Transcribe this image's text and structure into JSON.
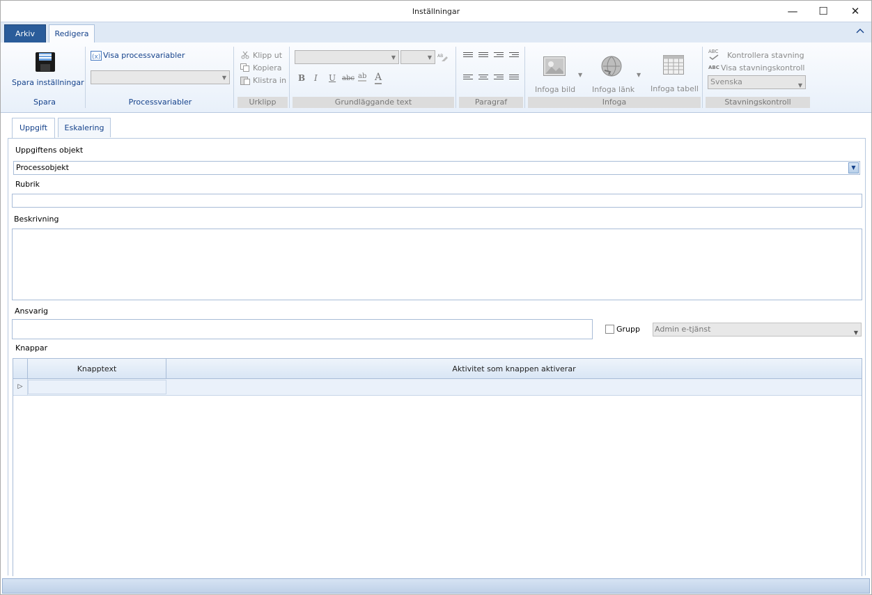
{
  "window": {
    "title": "Inställningar",
    "minimize": "—",
    "maximize": "☐",
    "close": "✕"
  },
  "ribbon_tabs": {
    "arkiv": "Arkiv",
    "redigera": "Redigera",
    "collapse_icon": "chevron-up-icon"
  },
  "ribbon": {
    "spara": {
      "button": "Spara inställningar",
      "group": "Spara"
    },
    "processvariabler": {
      "visa": "Visa processvariabler",
      "group": "Processvariabler"
    },
    "urklipp": {
      "klipp_ut": "Klipp ut",
      "kopiera": "Kopiera",
      "klistra_in": "Klistra in",
      "group": "Urklipp"
    },
    "grundlaggande": {
      "bold": "B",
      "italic": "I",
      "underline": "U",
      "strike": "abc",
      "highlight": "ab",
      "fontcolor": "A",
      "group": "Grundläggande text"
    },
    "paragraf": {
      "group": "Paragraf"
    },
    "infoga": {
      "bild": "Infoga bild",
      "lank": "Infoga länk",
      "tabell": "Infoga tabell",
      "group": "Infoga"
    },
    "stavning": {
      "kontrollera": "Kontrollera stavning",
      "visa": "Visa stavningskontroll",
      "language": "Svenska",
      "group": "Stavningskontroll",
      "abc": "ABC"
    }
  },
  "content_tabs": {
    "uppgift": "Uppgift",
    "eskalering": "Eskalering"
  },
  "form": {
    "uppgiftens_objekt_label": "Uppgiftens objekt",
    "uppgiftens_objekt_value": "Processobjekt",
    "rubrik_label": "Rubrik",
    "rubrik_value": "",
    "beskrivning_label": "Beskrivning",
    "ansvarig_label": "Ansvarig",
    "grupp_label": "Grupp",
    "grupp_select": "Admin e-tjänst",
    "knappar_label": "Knappar"
  },
  "grid": {
    "columns": [
      "Knapptext",
      "Aktivitet som knappen aktiverar"
    ],
    "row_indicator": "▷"
  },
  "colors": {
    "accent": "#15428b",
    "arkiv_tab": "#2a5c9a",
    "ribbon_bg": "#e8f0fa"
  }
}
